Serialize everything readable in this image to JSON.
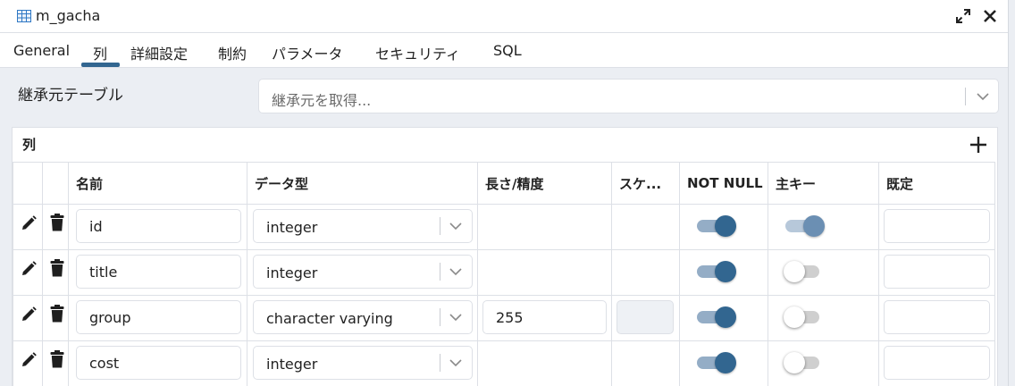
{
  "window": {
    "title": "m_gacha"
  },
  "tabs": [
    "General",
    "列",
    "詳細設定",
    "制約",
    "パラメータ",
    "セキュリティ",
    "SQL"
  ],
  "active_tab": "列",
  "inherit": {
    "label": "継承元テーブル",
    "placeholder": "継承元を取得..."
  },
  "columns_panel": {
    "title": "列",
    "headers": [
      "名前",
      "データ型",
      "長さ/精度",
      "スケ...",
      "NOT NULL",
      "主キー",
      "既定"
    ],
    "rows": [
      {
        "name": "id",
        "datatype": "integer",
        "length": "",
        "scale_enabled": false,
        "not_null": true,
        "primary_key": true,
        "default": ""
      },
      {
        "name": "title",
        "datatype": "integer",
        "length": "",
        "scale_enabled": false,
        "not_null": true,
        "primary_key": false,
        "default": ""
      },
      {
        "name": "group",
        "datatype": "character varying",
        "length": "255",
        "scale_enabled": true,
        "not_null": true,
        "primary_key": false,
        "default": ""
      },
      {
        "name": "cost",
        "datatype": "integer",
        "length": "",
        "scale_enabled": false,
        "not_null": true,
        "primary_key": false,
        "default": ""
      }
    ]
  },
  "colors": {
    "accent": "#326690",
    "toggle_on_track": "#94adc6",
    "toggle_off_track": "#cfcfcf",
    "background": "#ebeef3",
    "border": "#dde0e6"
  },
  "icons": {
    "title": "table-icon",
    "expand": "expand-icon",
    "close": "close-icon",
    "add": "plus-icon",
    "edit": "pencil-icon",
    "delete": "trash-icon",
    "dropdown": "chevron-down-icon"
  }
}
